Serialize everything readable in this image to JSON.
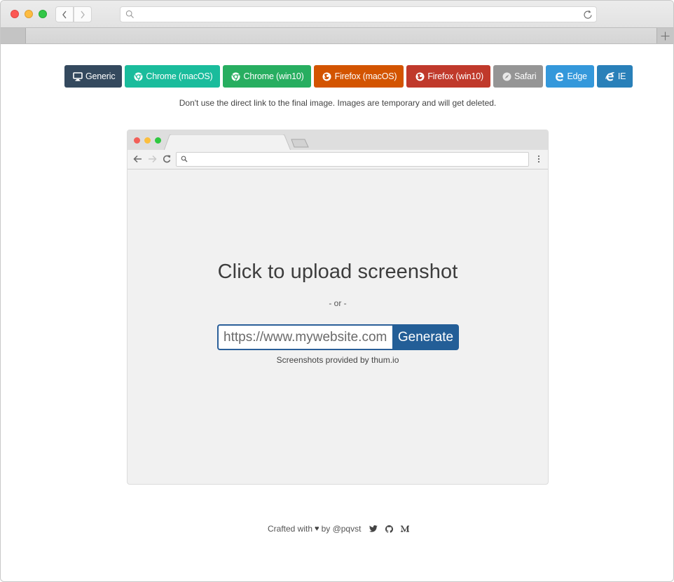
{
  "browser": {
    "url": "",
    "new_tab_label": "+"
  },
  "device_buttons": [
    {
      "label": "Generic",
      "icon": "monitor-icon",
      "color": "#34495e"
    },
    {
      "label": "Chrome (macOS)",
      "icon": "chrome-icon",
      "color": "#1abc9c"
    },
    {
      "label": "Chrome (win10)",
      "icon": "chrome-icon",
      "color": "#27ae60"
    },
    {
      "label": "Firefox (macOS)",
      "icon": "firefox-icon",
      "color": "#d35400"
    },
    {
      "label": "Firefox (win10)",
      "icon": "firefox-icon",
      "color": "#c0392b"
    },
    {
      "label": "Safari",
      "icon": "safari-icon",
      "color": "#959595"
    },
    {
      "label": "Edge",
      "icon": "edge-icon",
      "color": "#3498db"
    },
    {
      "label": "IE",
      "icon": "ie-icon",
      "color": "#2980b9"
    }
  ],
  "warning": "Don't use the direct link to the final image. Images are temporary and will get deleted.",
  "mock_browser": {
    "url": ""
  },
  "upload": {
    "title": "Click to upload screenshot",
    "or": "- or -",
    "url_placeholder": "https://www.mywebsite.com",
    "generate_label": "Generate",
    "provided_by": "Screenshots provided by thum.io"
  },
  "footer": {
    "crafted": "Crafted with",
    "heart": "♥",
    "by": "by @pqvst",
    "links": [
      "twitter-icon",
      "github-icon",
      "medium-icon"
    ]
  }
}
